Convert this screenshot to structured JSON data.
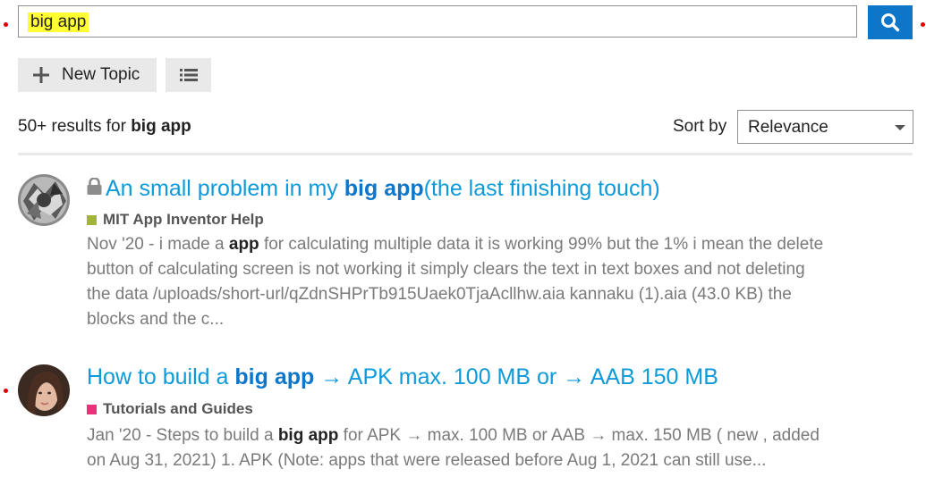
{
  "search": {
    "query": "big app",
    "button_icon": "search-icon"
  },
  "actions": {
    "new_topic_label": "New Topic",
    "new_topic_icon": "plus-icon",
    "list_icon": "list-icon"
  },
  "results_summary": {
    "count_text": "50+ results for",
    "query": "big app"
  },
  "sort": {
    "label": "Sort by",
    "selected": "Relevance"
  },
  "results": [
    {
      "locked": true,
      "title_pre": "An small problem in my",
      "title_bold": "big app",
      "title_post": "(the last finishing touch)",
      "category": "MIT App Inventor Help",
      "category_color": "#a3b43c",
      "blurb_pre": "Nov '20 - i made a",
      "blurb_bold": "app",
      "blurb_post": "for calculating multiple data it is working 99% but the 1% i mean the delete button of calculating screen is not working it simply clears the text in text boxes and not deleting the data /uploads/short-url/qZdnSHPrTb915Uaek0TjaAcllhw.aia kannaku (1).aia (43.0 KB) the blocks and the c..."
    },
    {
      "locked": false,
      "title_pre": "How to build a",
      "title_bold": "big app",
      "title_post": "→ APK max. 100 MB or → AAB 150 MB",
      "category": "Tutorials and Guides",
      "category_color": "#e8337a",
      "blurb_pre": "Jan '20 - Steps to build a",
      "blurb_bold": "big app",
      "blurb_post": "for APK → max. 100 MB or AAB → max. 150 MB ( new , added on Aug 31, 2021) 1. APK (Note: apps that were released before Aug 1, 2021 can still use..."
    }
  ]
}
